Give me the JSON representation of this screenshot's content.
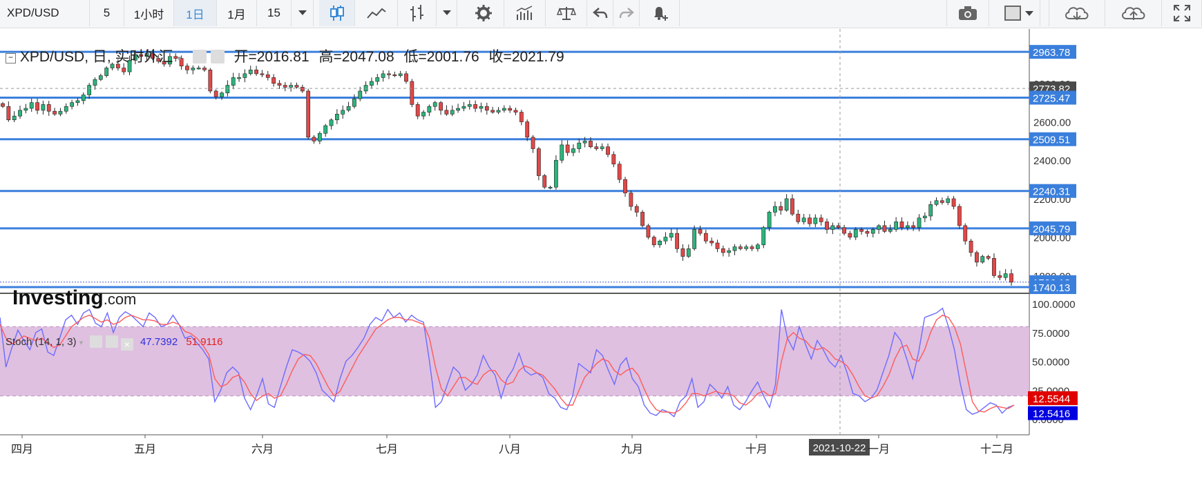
{
  "toolbar": {
    "symbol": "XPD/USD",
    "interval_5": "5",
    "interval_1h": "1小时",
    "interval_1d": "1日",
    "interval_1m": "1月",
    "interval_15": "15"
  },
  "legend": {
    "title": "XPD/USD, 日, 实时外汇",
    "open_label": "开=",
    "open": "2016.81",
    "high_label": "高=",
    "high": "2047.08",
    "low_label": "低=",
    "low": "2001.76",
    "close_label": "收=",
    "close": "2021.79"
  },
  "stoch_legend": {
    "name": "Stoch (14, 1, 3)",
    "k": "47.7392",
    "d": "51.9116"
  },
  "watermark": {
    "brand": "Investing",
    "suffix": ".com"
  },
  "colors": {
    "up": "#2db47b",
    "down": "#e04848",
    "hline": "#3a7fdc",
    "k": "#6b6bff",
    "d": "#ff5a5a",
    "band": "#dbb9dd"
  },
  "chart_data": [
    {
      "type": "candlestick",
      "title": "XPD/USD, 日, 实时外汇",
      "ylim": [
        1700,
        3000
      ],
      "x_ticks": [
        "四月",
        "五月",
        "六月",
        "七月",
        "八月",
        "九月",
        "十月",
        "2021-10-22",
        "一月",
        "十二月"
      ],
      "y_ticks": [
        "2800.00",
        "2600.00",
        "2400.00",
        "2200.00",
        "2000.00",
        "1800.00"
      ],
      "horizontal_levels": [
        2963.78,
        2725.47,
        2509.51,
        2240.31,
        2045.79,
        1740.13
      ],
      "price_labels": [
        "2963.78",
        "2773.82",
        "2725.47",
        "2600.00",
        "2509.51",
        "2400.00",
        "2240.31",
        "2045.79",
        "1766.13",
        "1740.13"
      ],
      "last_price": 1766.13,
      "crosshair_price": 2773.82,
      "crosshair_date": "2021-10-22",
      "close_series": [
        2680,
        2610,
        2630,
        2660,
        2670,
        2700,
        2660,
        2690,
        2655,
        2640,
        2655,
        2680,
        2700,
        2710,
        2740,
        2790,
        2820,
        2840,
        2880,
        2900,
        2880,
        2860,
        2920,
        2950,
        2940,
        2955,
        2930,
        2915,
        2900,
        2940,
        2930,
        2890,
        2870,
        2880,
        2880,
        2870,
        2760,
        2730,
        2750,
        2790,
        2830,
        2830,
        2850,
        2870,
        2850,
        2845,
        2830,
        2800,
        2790,
        2780,
        2790,
        2780,
        2760,
        2520,
        2500,
        2540,
        2580,
        2610,
        2640,
        2660,
        2680,
        2720,
        2760,
        2790,
        2810,
        2830,
        2850,
        2845,
        2840,
        2850,
        2810,
        2690,
        2630,
        2650,
        2680,
        2700,
        2660,
        2640,
        2660,
        2670,
        2680,
        2690,
        2670,
        2680,
        2660,
        2650,
        2660,
        2670,
        2660,
        2650,
        2600,
        2520,
        2460,
        2320,
        2260,
        2260,
        2400,
        2480,
        2440,
        2460,
        2490,
        2500,
        2470,
        2460,
        2470,
        2430,
        2380,
        2300,
        2230,
        2160,
        2130,
        2060,
        2000,
        1960,
        1980,
        2000,
        2020,
        1940,
        1900,
        1940,
        2040,
        2020,
        1980,
        1970,
        1940,
        1920,
        1930,
        1950,
        1940,
        1950,
        1940,
        1960,
        2050,
        2130,
        2160,
        2140,
        2200,
        2120,
        2080,
        2100,
        2070,
        2100,
        2080,
        2040,
        2060,
        2050,
        2020,
        2000,
        2040,
        2030,
        2020,
        2040,
        2060,
        2030,
        2040,
        2080,
        2050,
        2060,
        2050,
        2100,
        2110,
        2170,
        2190,
        2180,
        2200,
        2160,
        2060,
        1980,
        1920,
        1870,
        1900,
        1890,
        1800,
        1790,
        1810,
        1766
      ]
    },
    {
      "type": "line",
      "title": "Stoch (14, 1, 3)",
      "ylim": [
        0,
        100
      ],
      "y_ticks": [
        "100.0000",
        "75.0000",
        "50.0000",
        "25.0000",
        "0.0000"
      ],
      "band": [
        20,
        80
      ],
      "value_labels": [
        "12.5544",
        "12.5416"
      ],
      "series": [
        {
          "name": "%K",
          "values": [
            88,
            45,
            62,
            77,
            68,
            60,
            75,
            78,
            58,
            55,
            70,
            86,
            90,
            82,
            92,
            95,
            83,
            80,
            92,
            75,
            88,
            93,
            90,
            85,
            80,
            92,
            88,
            80,
            82,
            90,
            82,
            70,
            72,
            66,
            60,
            52,
            15,
            25,
            40,
            45,
            40,
            18,
            8,
            20,
            35,
            13,
            10,
            28,
            45,
            60,
            58,
            55,
            50,
            40,
            25,
            20,
            15,
            35,
            50,
            55,
            62,
            70,
            82,
            88,
            85,
            95,
            88,
            92,
            84,
            90,
            86,
            84,
            50,
            10,
            15,
            30,
            45,
            40,
            25,
            30,
            38,
            55,
            45,
            38,
            18,
            35,
            43,
            57,
            42,
            38,
            40,
            36,
            22,
            18,
            10,
            8,
            20,
            48,
            44,
            40,
            60,
            55,
            42,
            30,
            47,
            53,
            35,
            28,
            12,
            5,
            3,
            8,
            6,
            2,
            15,
            20,
            35,
            10,
            15,
            30,
            25,
            18,
            28,
            12,
            8,
            15,
            24,
            32,
            20,
            10,
            30,
            95,
            70,
            60,
            80,
            65,
            52,
            68,
            60,
            50,
            45,
            55,
            40,
            22,
            20,
            15,
            18,
            25,
            40,
            55,
            75,
            68,
            52,
            35,
            58,
            88,
            90,
            92,
            96,
            80,
            60,
            30,
            8,
            4,
            6,
            10,
            14,
            12,
            5,
            10,
            12
          ]
        },
        {
          "name": "%D",
          "values": [
            82,
            70,
            65,
            68,
            72,
            70,
            68,
            70,
            66,
            62,
            64,
            72,
            80,
            84,
            88,
            90,
            87,
            84,
            86,
            82,
            84,
            88,
            90,
            88,
            86,
            86,
            85,
            82,
            82,
            84,
            82,
            76,
            74,
            70,
            64,
            56,
            35,
            28,
            30,
            36,
            38,
            32,
            22,
            16,
            20,
            22,
            18,
            20,
            30,
            42,
            52,
            56,
            55,
            48,
            38,
            28,
            20,
            24,
            34,
            44,
            54,
            62,
            70,
            78,
            82,
            86,
            88,
            88,
            86,
            86,
            84,
            82,
            70,
            45,
            26,
            20,
            28,
            36,
            36,
            32,
            30,
            38,
            42,
            42,
            34,
            30,
            32,
            42,
            46,
            44,
            40,
            38,
            32,
            26,
            18,
            12,
            12,
            24,
            36,
            42,
            48,
            52,
            50,
            42,
            38,
            42,
            44,
            38,
            26,
            15,
            8,
            6,
            6,
            5,
            8,
            14,
            22,
            22,
            20,
            22,
            24,
            22,
            22,
            20,
            14,
            12,
            16,
            22,
            24,
            20,
            22,
            50,
            70,
            75,
            70,
            68,
            62,
            60,
            62,
            58,
            52,
            50,
            46,
            38,
            28,
            20,
            18,
            20,
            28,
            38,
            52,
            62,
            64,
            52,
            50,
            60,
            75,
            86,
            90,
            88,
            80,
            65,
            40,
            15,
            7,
            6,
            9,
            11,
            10,
            9,
            12
          ]
        }
      ]
    }
  ]
}
